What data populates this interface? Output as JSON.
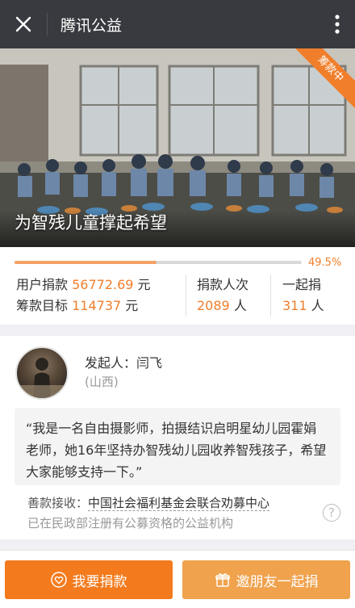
{
  "titlebar": {
    "title": "腾讯公益"
  },
  "hero": {
    "caption": "为智残儿童撑起希望",
    "ribbon": "筹款中"
  },
  "stats": {
    "progress_fraction": 0.495,
    "progress_label": "49.5%",
    "raised_label": "用户捐款",
    "raised_value": "56772.69",
    "raised_unit": "元",
    "goal_label": "筹款目标",
    "goal_value": "114737",
    "goal_unit": "元",
    "donors_label": "捐款人次",
    "donors_value": "2089",
    "donors_unit": "人",
    "together_label": "一起捐",
    "together_value": "311",
    "together_unit": "人"
  },
  "sponsor": {
    "label": "发起人：闫飞",
    "region": "(山西)",
    "quote": "“我是一名自由摄影师，拍摄结识启明星幼儿园霍娟老师，她16年坚持办智残幼儿园收养智残孩子，希望大家能够支持一下。”",
    "recipient_label": "善款接收：",
    "recipient_org": "中国社会福利基金会联合劝募中心",
    "recipient_note": "已在民政部注册有公募资格的公益机构",
    "help_icon": "?"
  },
  "actions": {
    "donate_label": "我要捐款",
    "invite_label": "邀朋友一起捐"
  },
  "colors": {
    "accent": "#f07e2b",
    "titlebar": "#393a3f",
    "invite": "#f0a24d"
  }
}
